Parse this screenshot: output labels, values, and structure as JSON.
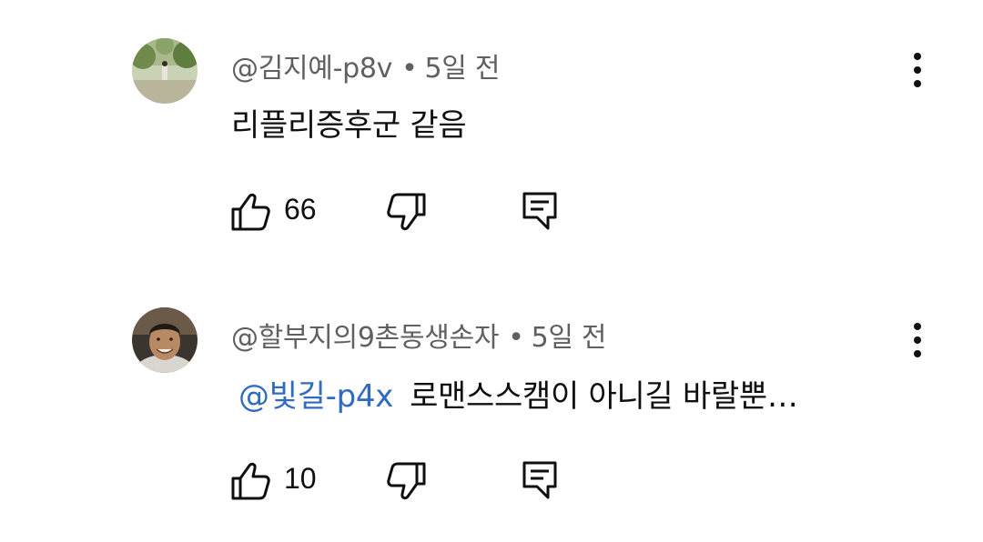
{
  "comments": [
    {
      "author": "@김지예-p8v",
      "separator": "•",
      "time": "5일 전",
      "mention": "",
      "text": "리플리증후군 같음",
      "likes": "66",
      "avatar_icon": "garden-photo-avatar"
    },
    {
      "author": "@할부지의9촌동생손자",
      "separator": "•",
      "time": "5일 전",
      "mention": "@빛길-p4x",
      "text": "로맨스스캠이 아니길 바랄뿐…",
      "likes": "10",
      "avatar_icon": "man-portrait-avatar"
    }
  ],
  "icons": {
    "like": "thumbs-up-icon",
    "dislike": "thumbs-down-icon",
    "reply": "reply-comment-icon",
    "more": "more-vertical-icon"
  },
  "colors": {
    "meta": "#606060",
    "mention": "#2f6bbf",
    "text": "#0f0f0f"
  }
}
